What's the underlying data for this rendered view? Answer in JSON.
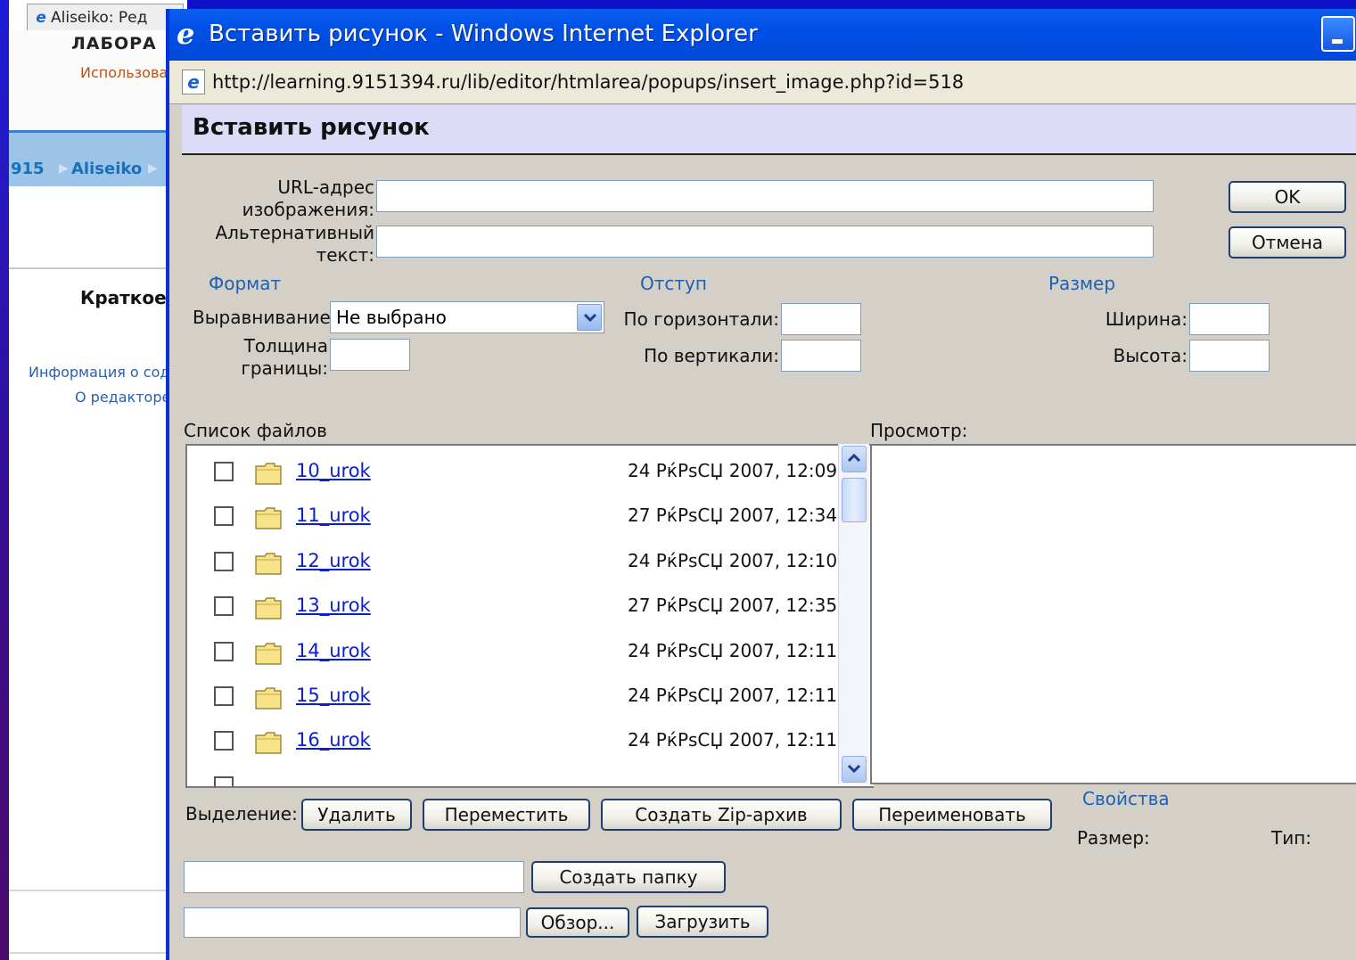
{
  "background_window": {
    "tab_title": "Aliseiko: Ред",
    "header_title": "ЛАБОРА",
    "user_text": "Использова",
    "breadcrumb": [
      "915",
      "Aliseiko"
    ],
    "section_title": "Краткое",
    "links": [
      "Информация о сод",
      "О редакторе"
    ]
  },
  "popup": {
    "title": "Вставить рисунок - Windows Internet Explorer",
    "address": "http://learning.9151394.ru/lib/editor/htmlarea/popups/insert_image.php?id=518",
    "page_title": "Вставить рисунок",
    "fields": {
      "url_label_1": "URL-адрес",
      "url_label_2": "изображения:",
      "url_value": "",
      "alt_label_1": "Альтернативный",
      "alt_label_2": "текст:",
      "alt_value": ""
    },
    "buttons": {
      "ok": "OK",
      "cancel": "Отмена"
    },
    "format": {
      "heading": "Формат",
      "align_label": "Выравнивание:",
      "align_value": "Не выбрано",
      "border_label_1": "Толщина",
      "border_label_2": "границы:",
      "border_value": ""
    },
    "spacing": {
      "heading": "Отступ",
      "horizontal_label": "По горизонтали:",
      "vertical_label": "По вертикали:",
      "horizontal_value": "",
      "vertical_value": ""
    },
    "size": {
      "heading": "Размер",
      "width_label": "Ширина:",
      "height_label": "Высота:",
      "width_value": "",
      "height_value": ""
    },
    "file_list_label": "Список файлов",
    "preview_label": "Просмотр:",
    "files": [
      {
        "name": "10_urok",
        "date": "24 РќРѕСЏ 2007, 12:09"
      },
      {
        "name": "11_urok",
        "date": "27 РќРѕСЏ 2007, 12:34"
      },
      {
        "name": "12_urok",
        "date": "24 РќРѕСЏ 2007, 12:10"
      },
      {
        "name": "13_urok",
        "date": "27 РќРѕСЏ 2007, 12:35"
      },
      {
        "name": "14_urok",
        "date": "24 РќРѕСЏ 2007, 12:11"
      },
      {
        "name": "15_urok",
        "date": "24 РќРѕСЏ 2007, 12:11"
      },
      {
        "name": "16_urok",
        "date": "24 РќРѕСЏ 2007, 12:11"
      }
    ],
    "selection": {
      "label": "Выделение:",
      "delete": "Удалить",
      "move": "Переместить",
      "zip": "Создать Zip-архив",
      "rename": "Переименовать"
    },
    "properties": {
      "heading": "Свойства",
      "size_label": "Размер:",
      "type_label": "Тип:"
    },
    "new_folder_button": "Создать папку",
    "browse_button": "Обзор...",
    "upload_button": "Загрузить",
    "new_folder_value": "",
    "upload_value": ""
  },
  "colors": {
    "title_bar": "#0050e6",
    "link": "#0a1fcf",
    "section": "#2060b0",
    "page_header_bg": "#dcdcf8"
  }
}
